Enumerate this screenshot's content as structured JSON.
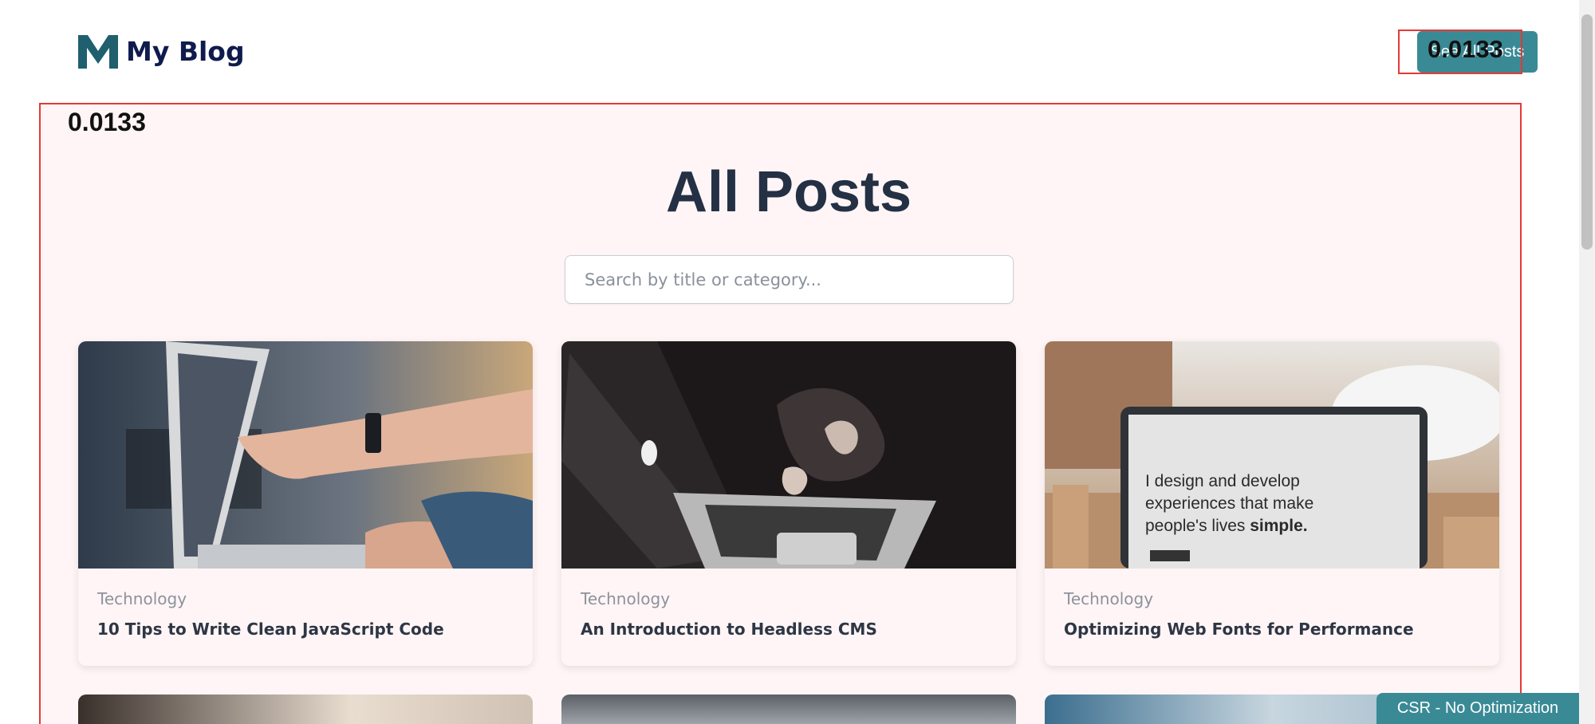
{
  "header": {
    "brand": "My Blog",
    "see_all_label": "See All Posts",
    "debug_score": "0.0133"
  },
  "main": {
    "debug_score": "0.0133",
    "title": "All Posts",
    "search": {
      "placeholder": "Search by title or category...",
      "value": ""
    },
    "cards": [
      {
        "category": "Technology",
        "title": "10 Tips to Write Clean JavaScript Code"
      },
      {
        "category": "Technology",
        "title": "An Introduction to Headless CMS"
      },
      {
        "category": "Technology",
        "title": "Optimizing Web Fonts for Performance",
        "image_text": "I design and develop experiences that make people's lives simple."
      }
    ]
  },
  "footer": {
    "mode_label": "CSR - No Optimization"
  },
  "colors": {
    "accent": "#3a8a96",
    "brand": "#0f1b4d",
    "highlight_border": "#e53935",
    "title": "#243044"
  }
}
